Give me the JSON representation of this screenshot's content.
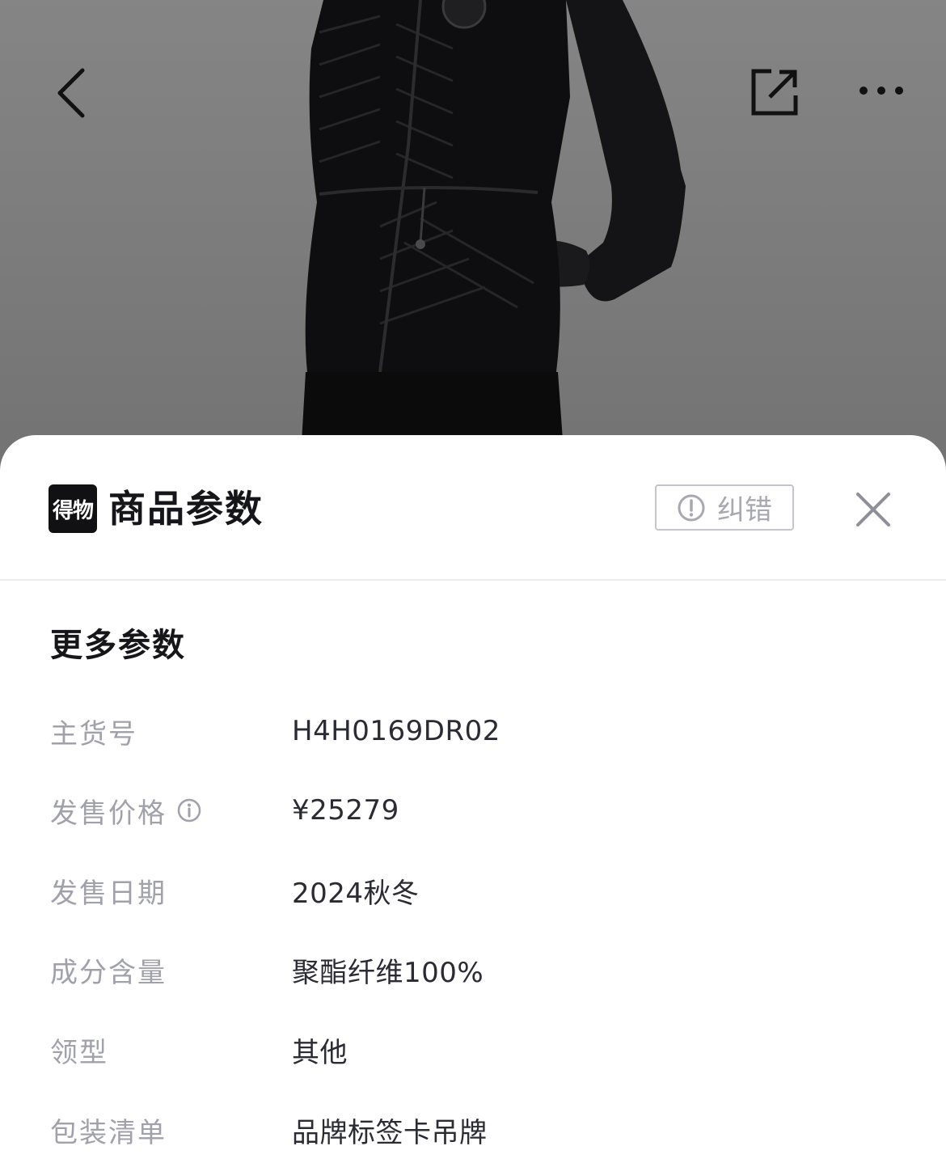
{
  "nav": {
    "back_icon": "chevron-left-icon",
    "share_icon": "share-external-icon",
    "more_icon": "more-dots-icon"
  },
  "sheet": {
    "logo_text": "得物",
    "title": "商品参数",
    "report_label": "纠错",
    "report_icon": "exclamation-circle-icon",
    "close_icon": "close-icon",
    "section_title": "更多参数",
    "params": [
      {
        "label": "主货号",
        "value": "H4H0169DR02"
      },
      {
        "label": "发售价格",
        "value": "¥25279",
        "info_icon": "info-icon"
      },
      {
        "label": "发售日期",
        "value": "2024秋冬"
      },
      {
        "label": "成分含量",
        "value": "聚酯纤维100%"
      },
      {
        "label": "领型",
        "value": "其他"
      },
      {
        "label": "包装清单",
        "value": "品牌标签卡吊牌"
      }
    ]
  },
  "colors": {
    "overlay": "#7d7d7d",
    "sheet_bg": "#ffffff",
    "label": "#a1a1ab",
    "value": "#2b2b33",
    "title": "#16161a"
  }
}
